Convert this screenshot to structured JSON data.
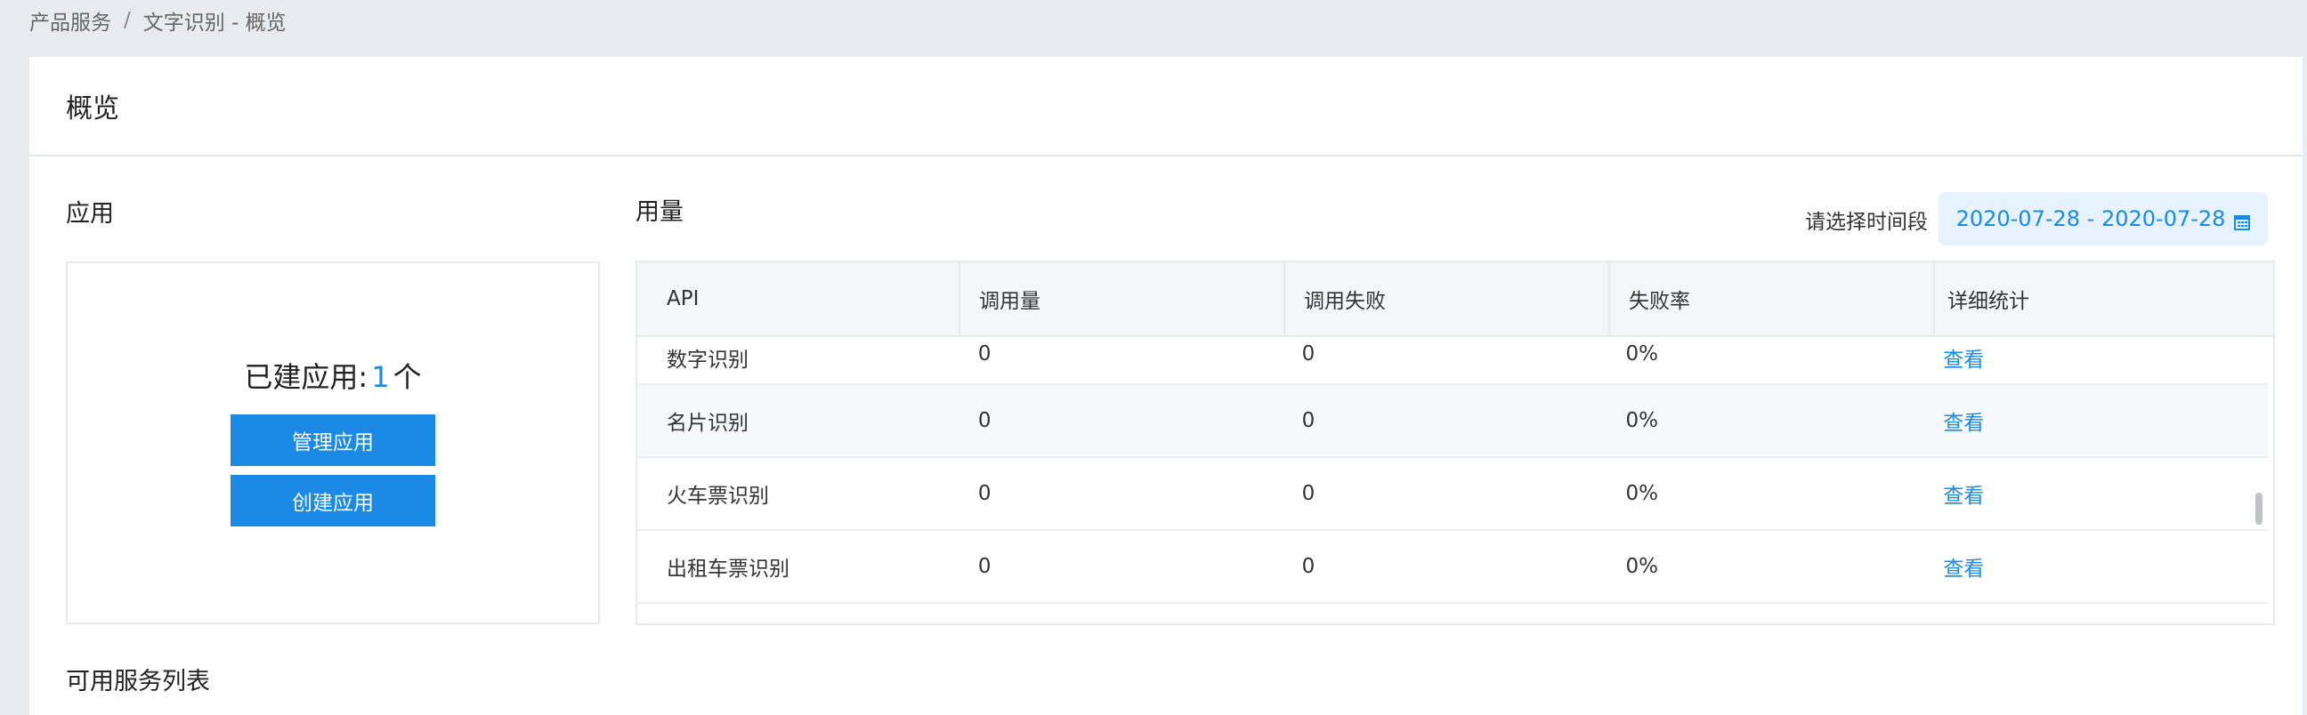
{
  "breadcrumb": {
    "root": "产品服务",
    "separator": "/",
    "current": "文字识别 - 概览"
  },
  "page": {
    "title": "概览"
  },
  "apps": {
    "section_title": "应用",
    "count_prefix": "已建应用:",
    "count": "1",
    "count_suffix": "个",
    "manage_label": "管理应用",
    "create_label": "创建应用"
  },
  "usage": {
    "section_title": "用量",
    "date_label": "请选择时间段",
    "date_range": "2020-07-28 - 2020-07-28",
    "columns": [
      "API",
      "调用量",
      "调用失败",
      "失败率",
      "详细统计"
    ],
    "rows": [
      {
        "api": "数字识别",
        "calls": "0",
        "failed": "0",
        "rate": "0%",
        "action": "查看"
      },
      {
        "api": "名片识别",
        "calls": "0",
        "failed": "0",
        "rate": "0%",
        "action": "查看"
      },
      {
        "api": "火车票识别",
        "calls": "0",
        "failed": "0",
        "rate": "0%",
        "action": "查看"
      },
      {
        "api": "出租车票识别",
        "calls": "0",
        "failed": "0",
        "rate": "0%",
        "action": "查看"
      }
    ]
  },
  "services": {
    "section_title": "可用服务列表"
  },
  "colors": {
    "accent": "#1a8ae6",
    "background": "#e8ebf0"
  },
  "icons": {
    "date_picker": "calendar-icon"
  }
}
